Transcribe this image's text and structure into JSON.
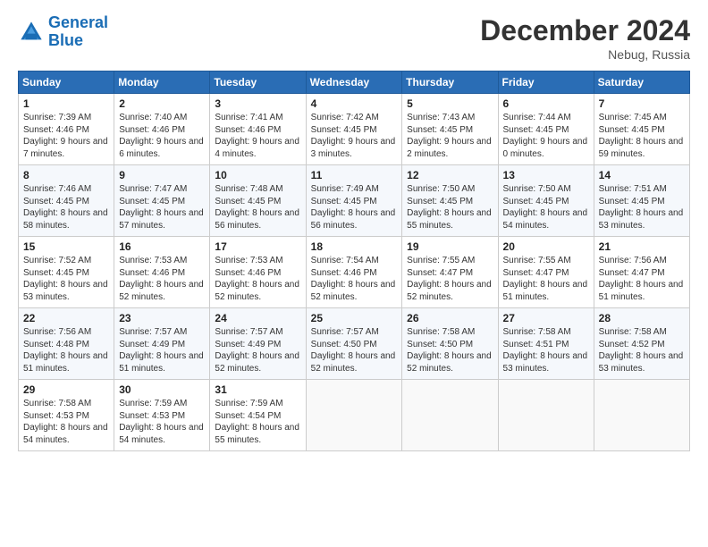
{
  "header": {
    "logo_line1": "General",
    "logo_line2": "Blue",
    "month_title": "December 2024",
    "location": "Nebug, Russia"
  },
  "days_of_week": [
    "Sunday",
    "Monday",
    "Tuesday",
    "Wednesday",
    "Thursday",
    "Friday",
    "Saturday"
  ],
  "weeks": [
    [
      {
        "day": 1,
        "info": "Sunrise: 7:39 AM\nSunset: 4:46 PM\nDaylight: 9 hours and 7 minutes."
      },
      {
        "day": 2,
        "info": "Sunrise: 7:40 AM\nSunset: 4:46 PM\nDaylight: 9 hours and 6 minutes."
      },
      {
        "day": 3,
        "info": "Sunrise: 7:41 AM\nSunset: 4:46 PM\nDaylight: 9 hours and 4 minutes."
      },
      {
        "day": 4,
        "info": "Sunrise: 7:42 AM\nSunset: 4:45 PM\nDaylight: 9 hours and 3 minutes."
      },
      {
        "day": 5,
        "info": "Sunrise: 7:43 AM\nSunset: 4:45 PM\nDaylight: 9 hours and 2 minutes."
      },
      {
        "day": 6,
        "info": "Sunrise: 7:44 AM\nSunset: 4:45 PM\nDaylight: 9 hours and 0 minutes."
      },
      {
        "day": 7,
        "info": "Sunrise: 7:45 AM\nSunset: 4:45 PM\nDaylight: 8 hours and 59 minutes."
      }
    ],
    [
      {
        "day": 8,
        "info": "Sunrise: 7:46 AM\nSunset: 4:45 PM\nDaylight: 8 hours and 58 minutes."
      },
      {
        "day": 9,
        "info": "Sunrise: 7:47 AM\nSunset: 4:45 PM\nDaylight: 8 hours and 57 minutes."
      },
      {
        "day": 10,
        "info": "Sunrise: 7:48 AM\nSunset: 4:45 PM\nDaylight: 8 hours and 56 minutes."
      },
      {
        "day": 11,
        "info": "Sunrise: 7:49 AM\nSunset: 4:45 PM\nDaylight: 8 hours and 56 minutes."
      },
      {
        "day": 12,
        "info": "Sunrise: 7:50 AM\nSunset: 4:45 PM\nDaylight: 8 hours and 55 minutes."
      },
      {
        "day": 13,
        "info": "Sunrise: 7:50 AM\nSunset: 4:45 PM\nDaylight: 8 hours and 54 minutes."
      },
      {
        "day": 14,
        "info": "Sunrise: 7:51 AM\nSunset: 4:45 PM\nDaylight: 8 hours and 53 minutes."
      }
    ],
    [
      {
        "day": 15,
        "info": "Sunrise: 7:52 AM\nSunset: 4:45 PM\nDaylight: 8 hours and 53 minutes."
      },
      {
        "day": 16,
        "info": "Sunrise: 7:53 AM\nSunset: 4:46 PM\nDaylight: 8 hours and 52 minutes."
      },
      {
        "day": 17,
        "info": "Sunrise: 7:53 AM\nSunset: 4:46 PM\nDaylight: 8 hours and 52 minutes."
      },
      {
        "day": 18,
        "info": "Sunrise: 7:54 AM\nSunset: 4:46 PM\nDaylight: 8 hours and 52 minutes."
      },
      {
        "day": 19,
        "info": "Sunrise: 7:55 AM\nSunset: 4:47 PM\nDaylight: 8 hours and 52 minutes."
      },
      {
        "day": 20,
        "info": "Sunrise: 7:55 AM\nSunset: 4:47 PM\nDaylight: 8 hours and 51 minutes."
      },
      {
        "day": 21,
        "info": "Sunrise: 7:56 AM\nSunset: 4:47 PM\nDaylight: 8 hours and 51 minutes."
      }
    ],
    [
      {
        "day": 22,
        "info": "Sunrise: 7:56 AM\nSunset: 4:48 PM\nDaylight: 8 hours and 51 minutes."
      },
      {
        "day": 23,
        "info": "Sunrise: 7:57 AM\nSunset: 4:49 PM\nDaylight: 8 hours and 51 minutes."
      },
      {
        "day": 24,
        "info": "Sunrise: 7:57 AM\nSunset: 4:49 PM\nDaylight: 8 hours and 52 minutes."
      },
      {
        "day": 25,
        "info": "Sunrise: 7:57 AM\nSunset: 4:50 PM\nDaylight: 8 hours and 52 minutes."
      },
      {
        "day": 26,
        "info": "Sunrise: 7:58 AM\nSunset: 4:50 PM\nDaylight: 8 hours and 52 minutes."
      },
      {
        "day": 27,
        "info": "Sunrise: 7:58 AM\nSunset: 4:51 PM\nDaylight: 8 hours and 53 minutes."
      },
      {
        "day": 28,
        "info": "Sunrise: 7:58 AM\nSunset: 4:52 PM\nDaylight: 8 hours and 53 minutes."
      }
    ],
    [
      {
        "day": 29,
        "info": "Sunrise: 7:58 AM\nSunset: 4:53 PM\nDaylight: 8 hours and 54 minutes."
      },
      {
        "day": 30,
        "info": "Sunrise: 7:59 AM\nSunset: 4:53 PM\nDaylight: 8 hours and 54 minutes."
      },
      {
        "day": 31,
        "info": "Sunrise: 7:59 AM\nSunset: 4:54 PM\nDaylight: 8 hours and 55 minutes."
      },
      null,
      null,
      null,
      null
    ]
  ]
}
